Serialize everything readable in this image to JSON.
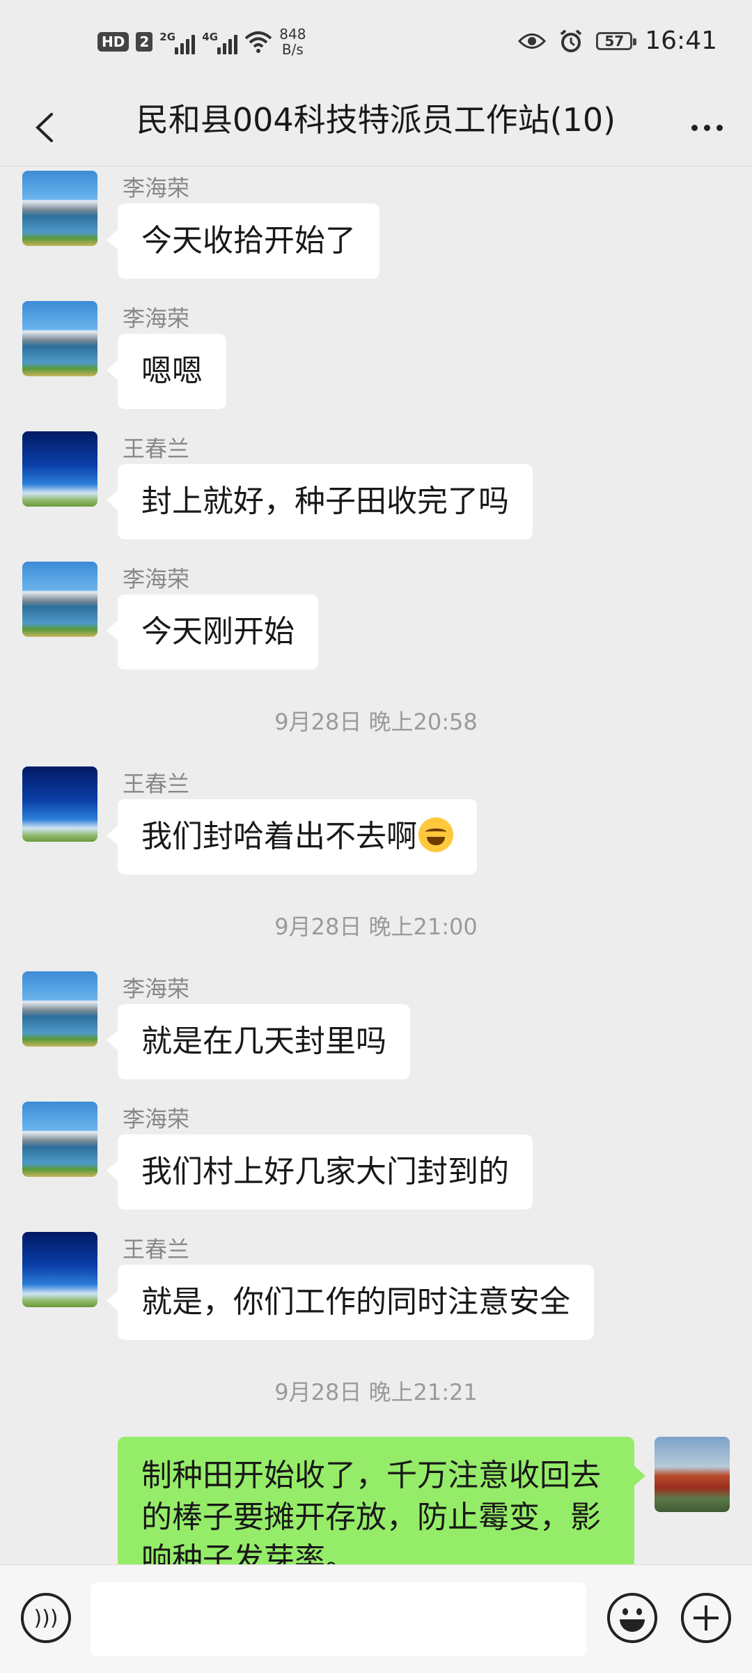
{
  "status_bar": {
    "hd": "HD",
    "sim": "2",
    "signal1": "2G",
    "signal2": "4G",
    "net_speed_value": "848",
    "net_speed_unit": "B/s",
    "battery": "57",
    "time": "16:41"
  },
  "header": {
    "title": "民和县004科技特派员工作站(10)"
  },
  "messages": [
    {
      "sender": "李海荣",
      "text": "今天收拾开始了",
      "avatar": "mountain-lake-avatar"
    },
    {
      "sender": "李海荣",
      "text": "嗯嗯",
      "avatar": "mountain-lake-avatar"
    },
    {
      "sender": "王春兰",
      "text": "封上就好，种子田收完了吗",
      "avatar": "blue-sky-avatar"
    },
    {
      "sender": "李海荣",
      "text": "今天刚开始",
      "avatar": "mountain-lake-avatar"
    },
    {
      "timestamp": "9月28日 晚上20:58"
    },
    {
      "sender": "王春兰",
      "text": "我们封哈着出不去啊",
      "emoji": "face-with-tears-of-joy",
      "avatar": "blue-sky-avatar"
    },
    {
      "timestamp": "9月28日 晚上21:00"
    },
    {
      "sender": "李海荣",
      "text": "就是在几天封里吗",
      "avatar": "mountain-lake-avatar"
    },
    {
      "sender": "李海荣",
      "text": "我们村上好几家大门封到的",
      "avatar": "mountain-lake-avatar"
    },
    {
      "sender": "王春兰",
      "text": "就是，你们工作的同时注意安全",
      "avatar": "blue-sky-avatar"
    },
    {
      "timestamp": "9月28日 晚上21:21"
    },
    {
      "self": true,
      "text": "制种田开始收了，千万注意收回去的棒子要摊开存放，防止霉变，影响种子发芽率。",
      "avatar": "tiananmen-avatar"
    }
  ],
  "input_bar": {
    "voice_icon": "voice-icon",
    "emoji_icon": "emoji-icon",
    "plus_icon": "plus-icon",
    "text_value": ""
  }
}
